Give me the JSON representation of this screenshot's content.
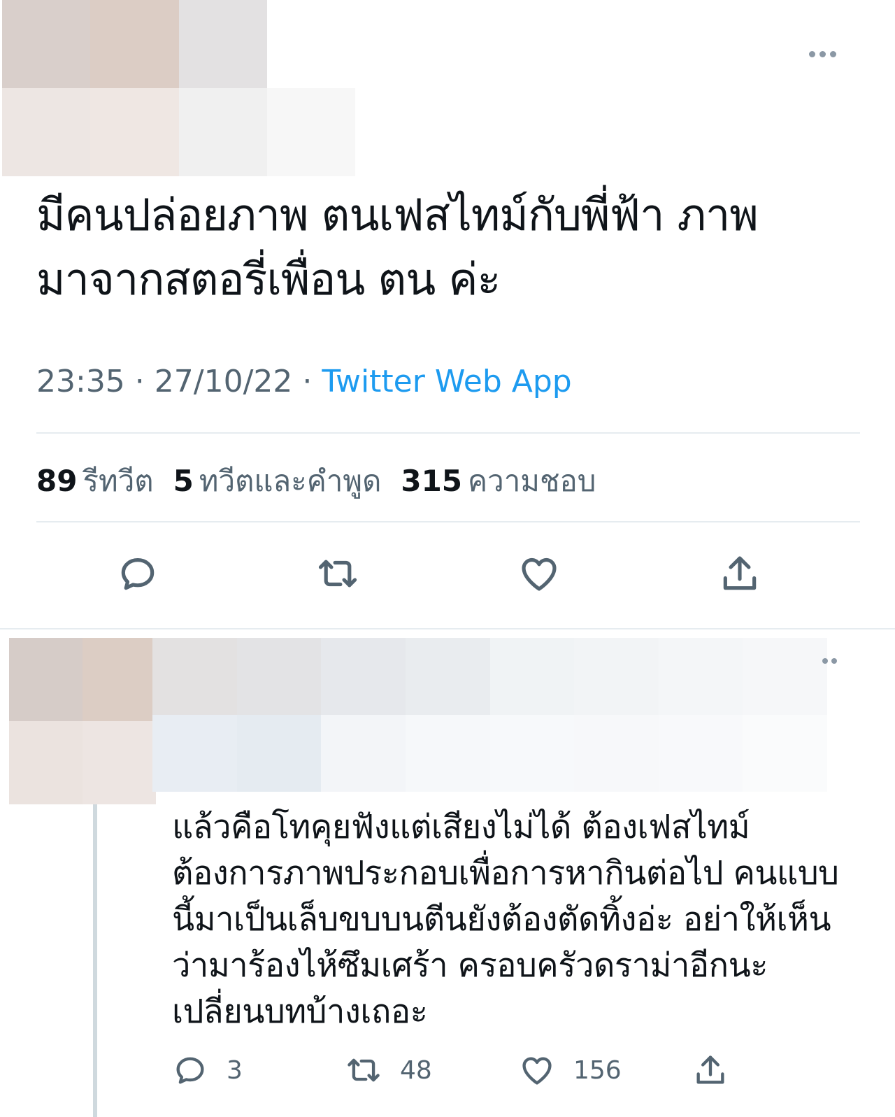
{
  "colors": {
    "text": "#0f1419",
    "muted": "#536471",
    "accent": "#1d9bf0",
    "border": "#e6ecf0",
    "icon": "#536471"
  },
  "tweet": {
    "text_line1": "มีคนปล่อยภาพ ตนเฟสไทม์กับพี่ฟ้า ภาพ",
    "text_line2": "มาจากสตอรี่เพื่อน ตน ค่ะ",
    "time": "23:35",
    "date": "27/10/22",
    "separator": " · ",
    "source": "Twitter Web App",
    "more_icon": "more-horizontal-icon"
  },
  "stats": {
    "retweets_count": "89",
    "retweets_label": "รีทวีต",
    "quotes_count": "5",
    "quotes_label": "ทวีตและคำพูด",
    "likes_count": "315",
    "likes_label": "ความชอบ"
  },
  "actions": [
    {
      "name": "reply",
      "icon": "reply-bubble-icon"
    },
    {
      "name": "retweet",
      "icon": "retweet-icon"
    },
    {
      "name": "like",
      "icon": "heart-icon"
    },
    {
      "name": "share",
      "icon": "share-upload-icon"
    }
  ],
  "reply": {
    "lines": [
      "แล้วคือโทคุยฟังแต่เสียงไม่ได้ ต้องเฟสไทม์",
      "ต้องการภาพประกอบเพื่อการหากินต่อไป คนแบบ",
      "นี้มาเป็นเล็บขบบนตีนยังต้องตัดทิ้งอ่ะ อย่าให้เห็น",
      "ว่ามาร้องไห้ซึมเศร้า ครอบครัวดราม่าอีกนะ",
      "เปลี่ยนบทบ้างเถอะ"
    ],
    "reply_count": "3",
    "retweet_count": "48",
    "like_count": "156"
  }
}
